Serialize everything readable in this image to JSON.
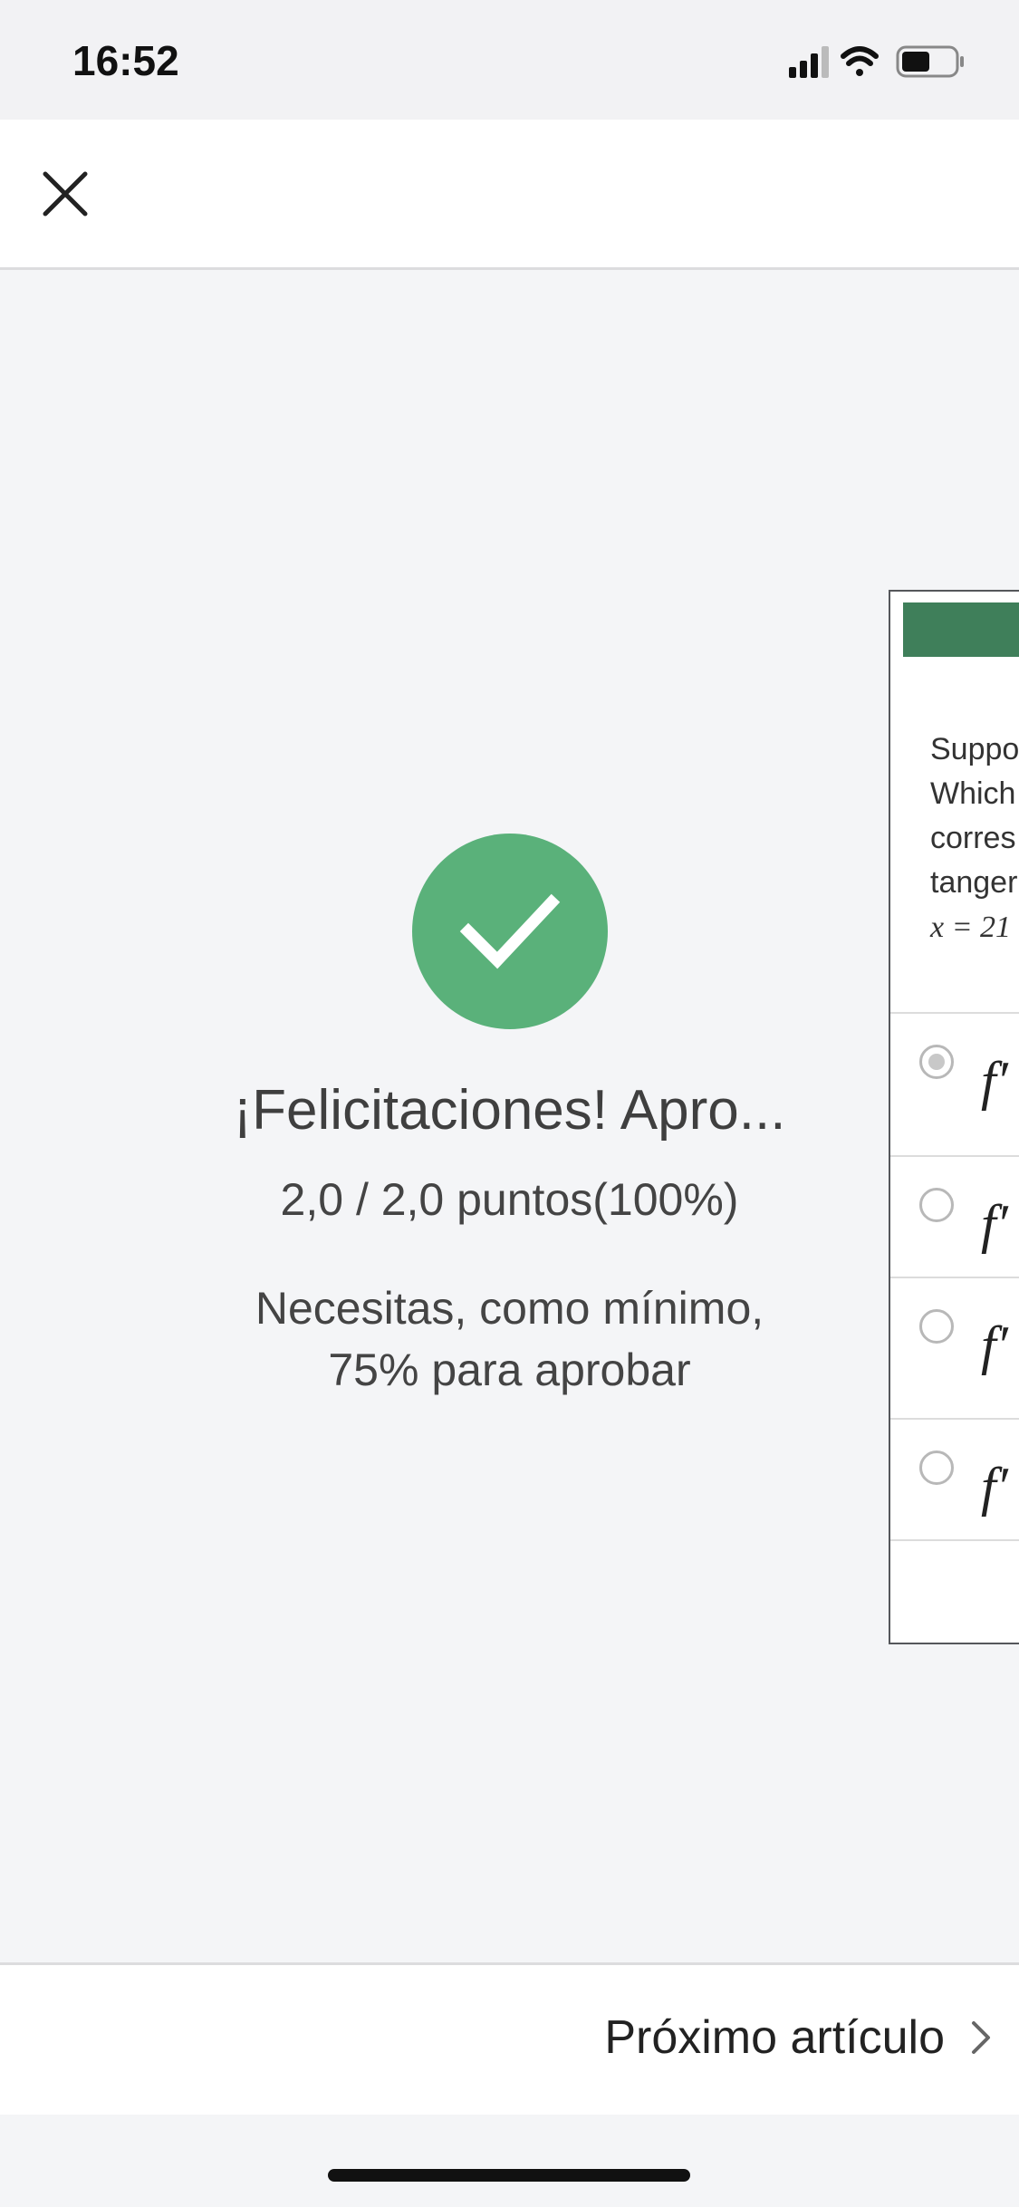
{
  "status_bar": {
    "time": "16:52",
    "icons": [
      "signal-icon",
      "wifi-icon",
      "battery-icon"
    ]
  },
  "top_bar": {
    "close_icon": "close-icon"
  },
  "result": {
    "status_icon": "check-icon",
    "status_color": "#5ab17a",
    "congrats_title": "¡Felicitaciones! Apro...",
    "score": "2,0 / 2,0 puntos(100%)",
    "requirement_line1": "Necesitas, como mínimo,",
    "requirement_line2": "75% para aprobar"
  },
  "quiz_preview": {
    "header_color": "#3f7f5a",
    "question_lines": [
      "Suppo",
      "Which",
      "corres",
      "tanger",
      "x = 21"
    ],
    "options": [
      {
        "text": "f′",
        "selected": true
      },
      {
        "text": "f′",
        "selected": false
      },
      {
        "text": "f′",
        "selected": false
      },
      {
        "text": "f′",
        "selected": false
      }
    ]
  },
  "bottom_bar": {
    "next_label": "Próximo artículo",
    "next_icon": "chevron-right-icon"
  }
}
